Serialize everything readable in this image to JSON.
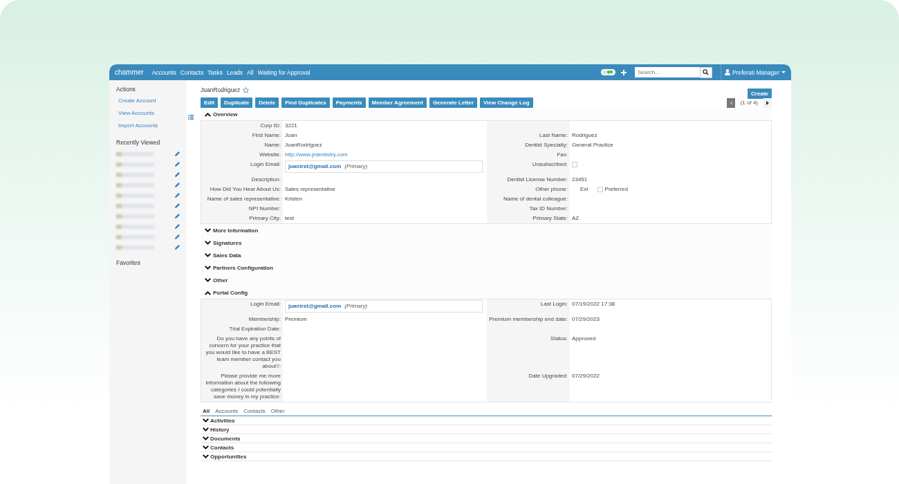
{
  "navbar": {
    "logo": "chammer",
    "links": [
      "Accounts",
      "Contacts",
      "Tasks",
      "Leads",
      "All",
      "Waiting for Approval"
    ],
    "chat_count": "0",
    "search": {
      "placeholder": "Search..."
    },
    "user": "Preferati Manager"
  },
  "sidebar": {
    "actions_title": "Actions",
    "actions": [
      "Create Account",
      "View Accounts",
      "Import Accounts"
    ],
    "recent_title": "Recently Viewed",
    "recent": [
      {
        "kind": "blurred"
      },
      {
        "kind": "blurred"
      },
      {
        "kind": "blurred"
      },
      {
        "kind": "blurred"
      },
      {
        "kind": "blurred"
      },
      {
        "kind": "blurred"
      },
      {
        "kind": "blurred"
      },
      {
        "kind": "blurred"
      },
      {
        "kind": "blurred"
      },
      {
        "kind": "blurred"
      }
    ],
    "favorites_title": "Favorites"
  },
  "record": {
    "title": "JuanRodriguez",
    "create": "Create",
    "buttons": [
      "Edit",
      "Duplicate",
      "Delete",
      "Find Duplicates",
      "Payments",
      "Member Agreement",
      "Generate Letter",
      "View Change Log"
    ],
    "pager": {
      "text": "(1 of 4)",
      "prev_disabled": true
    }
  },
  "sections": [
    {
      "title": "Overview",
      "expanded": true,
      "rows": [
        {
          "left": {
            "label": "Corp ID:",
            "kind": "text",
            "value": "3221"
          }
        },
        {
          "left": {
            "label": "First Name:",
            "kind": "text",
            "value": "Juan"
          },
          "right": {
            "label": "Last Name:",
            "kind": "text",
            "value": "Rodriguez"
          }
        },
        {
          "left": {
            "label": "Name:",
            "kind": "text",
            "value": "JuanRodriguez"
          },
          "right": {
            "label": "Dentist Specialty:",
            "kind": "text",
            "value": "General Practice"
          }
        },
        {
          "left": {
            "label": "Website:",
            "kind": "link",
            "value": "http://www.jrdentistry.com"
          },
          "right": {
            "label": "Fax:",
            "kind": "text"
          }
        },
        {
          "left": {
            "label": "Login Email:",
            "kind": "email",
            "value": "juanirst@gmail.com",
            "tag": "(Primary)"
          },
          "right": {
            "label": "Unsubscribed:",
            "kind": "checkbox",
            "checked": false
          }
        },
        {
          "left": {
            "label": "Description:",
            "kind": "text"
          },
          "right": {
            "label": "Dentist License Number:",
            "kind": "text",
            "value": "23451"
          }
        },
        {
          "left": {
            "label": "How Did You Hear About Us:",
            "kind": "text",
            "value": "Sales representative"
          },
          "right": {
            "label": "Other phone:",
            "kind": "phone",
            "ext": "Ext",
            "preferred": "Preferred",
            "checked": false
          }
        },
        {
          "left": {
            "label": "Name of sales representative:",
            "kind": "text",
            "value": "Kristen"
          },
          "right": {
            "label": "Name of dental colleague:",
            "kind": "text"
          }
        },
        {
          "left": {
            "label": "NPI Number:",
            "kind": "text"
          },
          "right": {
            "label": "Tax ID Number:",
            "kind": "text"
          }
        },
        {
          "left": {
            "label": "Primary City:",
            "kind": "text",
            "value": "test"
          },
          "right": {
            "label": "Primary State:",
            "kind": "text",
            "value": "AZ"
          }
        }
      ]
    },
    {
      "title": "More Information",
      "expanded": false
    },
    {
      "title": "Signatures",
      "expanded": false
    },
    {
      "title": "Sales Data",
      "expanded": false
    },
    {
      "title": "Partners Configuration",
      "expanded": false
    },
    {
      "title": "Other",
      "expanded": false
    },
    {
      "title": "Portal Config",
      "expanded": true,
      "rows": [
        {
          "left": {
            "label": "Login Email:",
            "kind": "email",
            "value": "juanirst@gmail.com",
            "tag": "(Primary)"
          },
          "right": {
            "label": "Last Login:",
            "kind": "text",
            "value": "07/19/2022 17:38"
          }
        },
        {
          "left": {
            "label": "Membership:",
            "kind": "text",
            "value": "Premium"
          },
          "right": {
            "label": "Premium membership end date:",
            "kind": "text",
            "value": "07/29/2023"
          }
        },
        {
          "left": {
            "label": "Trial Expiration Date:",
            "kind": "text"
          }
        },
        {
          "left": {
            "label": "Do you have any points of concern for your practice that you would like to have a BEST team member contact you about?:",
            "kind": "text"
          },
          "right": {
            "label": "Status:",
            "kind": "text",
            "value": "Approved"
          }
        },
        {
          "left": {
            "label": "Please provide me more information about the following categories I could potentially save money in my practice:",
            "kind": "text"
          },
          "right": {
            "label": "Date Upgraded:",
            "kind": "text",
            "value": "07/29/2022"
          }
        }
      ]
    }
  ],
  "related_tabs": [
    {
      "label": "All",
      "selected": true
    },
    {
      "label": "Accounts",
      "selected": false
    },
    {
      "label": "Contacts",
      "selected": false
    },
    {
      "label": "Other",
      "selected": false
    }
  ],
  "related": [
    "Activities",
    "History",
    "Documents",
    "Contacts",
    "Opportunities"
  ]
}
